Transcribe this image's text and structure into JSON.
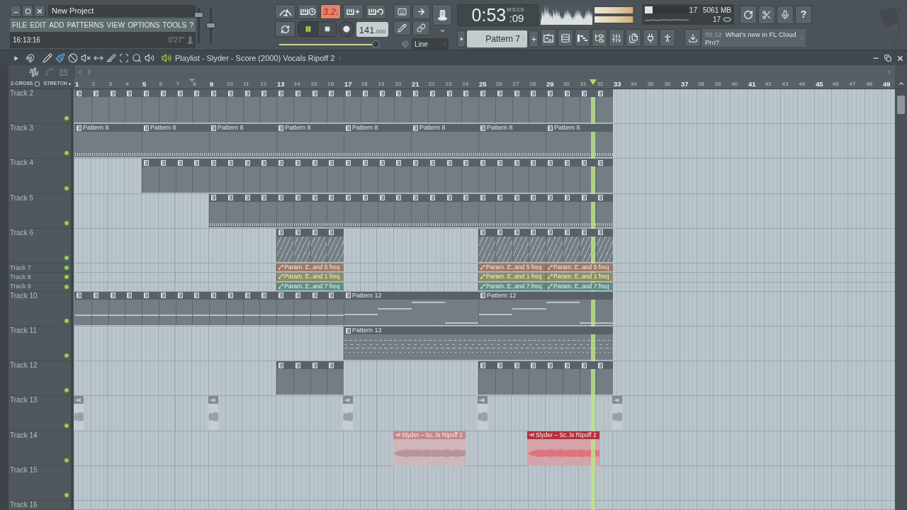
{
  "main_window": {
    "title": "New Project",
    "menu": [
      "FILE",
      "EDIT",
      "ADD",
      "PATTERNS",
      "VIEW",
      "OPTIONS",
      "TOOLS",
      "?"
    ],
    "clock": "16:13:16",
    "elapsed": "0'27\""
  },
  "master": {
    "volume": {
      "level": 0.8
    },
    "pitch": {
      "level": 0.5
    }
  },
  "transport": {
    "toggles": [
      {
        "kind": "metronome",
        "on": false
      },
      {
        "kind": "wait",
        "on": false
      },
      {
        "kind": "countdown",
        "label": "3.2.",
        "on": true
      },
      {
        "kind": "blend",
        "on": false
      },
      {
        "kind": "loop_record",
        "on": false
      }
    ],
    "playing": true,
    "tempo": "141",
    "tempo_decimals": ".000",
    "song_position": {
      "level": 0.965
    }
  },
  "snap": {
    "value": "Line"
  },
  "time": {
    "main": "0:53",
    "sub": ":09",
    "unit": "M:S:CS"
  },
  "pattern_selector": {
    "value": "Pattern 7"
  },
  "output_meters": [
    {
      "level": 0.97
    },
    {
      "level": 0.97
    }
  ],
  "performance": {
    "cpu": "17",
    "cpu_meter": {
      "level": 0.17
    },
    "memory": "5061 MB",
    "polyphony": "17"
  },
  "help": "?",
  "news": {
    "date": "09.12",
    "text": "What’s new in FL Cloud Pro?"
  },
  "playlist": {
    "title": "Playlist - Slyder - Score (2000) Vocals Ripoff 2",
    "tools": [
      {
        "kind": "draw",
        "selected": false
      },
      {
        "kind": "paint",
        "selected": true
      },
      {
        "kind": "delete",
        "selected": false
      },
      {
        "kind": "mute",
        "selected": false
      },
      {
        "kind": "slip",
        "selected": false
      },
      {
        "kind": "slice",
        "selected": false
      },
      {
        "kind": "select",
        "selected": false
      },
      {
        "kind": "zoom",
        "selected": false
      },
      {
        "kind": "playback",
        "selected": false
      }
    ],
    "zcross": {
      "label": "Z-CROSS",
      "checked": false
    },
    "stretch": {
      "label": "STRETCH"
    },
    "ruler": [
      "1",
      "2",
      "3",
      "4",
      "5",
      "6",
      "7",
      "8",
      "9",
      "10",
      "11",
      "12",
      "13",
      "14",
      "15",
      "16",
      "17",
      "18",
      "19",
      "20",
      "21",
      "22",
      "23",
      "24",
      "25",
      "26",
      "27",
      "28",
      "29",
      "30",
      "31",
      "32",
      "33",
      "34",
      "35",
      "36",
      "37",
      "38",
      "39",
      "40",
      "41",
      "42",
      "43",
      "44",
      "45",
      "46",
      "47",
      "48",
      "49"
    ],
    "tracks": [
      {
        "name": "Track 2",
        "kind": "full",
        "enabled": true
      },
      {
        "name": "Track 3",
        "kind": "full",
        "enabled": true,
        "clips": [
          {
            "kind": "pattern",
            "label": "Pattern 8"
          },
          {
            "kind": "pattern",
            "label": "Pattern 8"
          },
          {
            "kind": "pattern",
            "label": "Pattern 8"
          },
          {
            "kind": "pattern",
            "label": "Pattern 8"
          },
          {
            "kind": "pattern",
            "label": "Pattern 8"
          },
          {
            "kind": "pattern",
            "label": "Pattern 8"
          },
          {
            "kind": "pattern",
            "label": "Pattern 8"
          },
          {
            "kind": "pattern",
            "label": "Pattern 8"
          }
        ]
      },
      {
        "name": "Track 4",
        "kind": "full",
        "enabled": true
      },
      {
        "name": "Track 5",
        "kind": "full",
        "enabled": true
      },
      {
        "name": "Track 6",
        "kind": "full",
        "enabled": true
      },
      {
        "name": "Track 7",
        "kind": "compact",
        "enabled": true,
        "clips": [
          {
            "kind": "automation",
            "label": "Param. E..and 5 freq",
            "color": "#9d7868"
          },
          {
            "kind": "automation",
            "label": "Param. E..and 5 freq",
            "color": "#9d7868"
          },
          {
            "kind": "automation",
            "label": "Param. E..and 5 freq",
            "color": "#9d7868"
          }
        ]
      },
      {
        "name": "Track 8",
        "kind": "compact",
        "enabled": true,
        "clips": [
          {
            "kind": "automation",
            "label": "Param. E..and 1 freq",
            "color": "#8e8f62"
          },
          {
            "kind": "automation",
            "label": "Param. E..and 1 freq",
            "color": "#8e8f62"
          },
          {
            "kind": "automation",
            "label": "Param. E..and 1 freq",
            "color": "#8e8f62"
          }
        ]
      },
      {
        "name": "Track 9",
        "kind": "compact",
        "enabled": true,
        "clips": [
          {
            "kind": "automation",
            "label": "Param. E..and 7 freq",
            "color": "#5e8f87"
          },
          {
            "kind": "automation",
            "label": "Param. E..and 7 freq",
            "color": "#5e8f87"
          },
          {
            "kind": "automation",
            "label": "Param. E..and 7 freq",
            "color": "#5e8f87"
          }
        ]
      },
      {
        "name": "Track 10",
        "kind": "full",
        "enabled": true,
        "clips": [
          {
            "kind": "pattern",
            "label": "Pattern 12"
          },
          {
            "kind": "pattern",
            "label": "Pattern 12"
          }
        ]
      },
      {
        "name": "Track 11",
        "kind": "full",
        "enabled": true,
        "clips": [
          {
            "kind": "pattern",
            "label": "Pattern 13"
          }
        ]
      },
      {
        "name": "Track 12",
        "kind": "full",
        "enabled": true
      },
      {
        "name": "Track 13",
        "kind": "full",
        "enabled": true
      },
      {
        "name": "Track 14",
        "kind": "full",
        "enabled": true,
        "clips": [
          {
            "kind": "audio",
            "label": "Slyder – Sc..ls Ripoff 2",
            "muted": true
          },
          {
            "kind": "audio",
            "label": "Slyder – Sc..ls Ripoff 2",
            "muted": false
          }
        ]
      },
      {
        "name": "Track 15",
        "kind": "full",
        "enabled": true
      },
      {
        "name": "Track 16",
        "kind": "full"
      }
    ]
  }
}
